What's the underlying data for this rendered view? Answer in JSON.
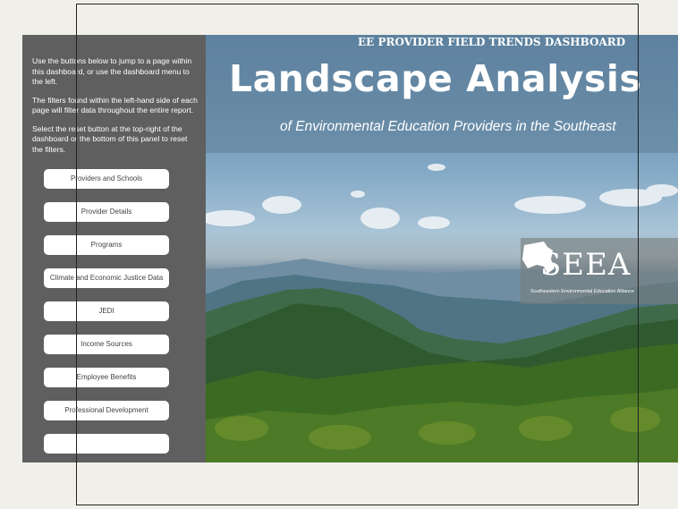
{
  "sidebar": {
    "intro": [
      "Use the buttons below to jump to a page within this dashboard, or use the dashboard menu to the left.",
      "The filters found within the left-hand side of each page will filter data throughout the entire report.",
      "Select the reset button at the top-right of the dashboard or the bottom of this panel to reset the filters."
    ],
    "nav": [
      "Providers and Schools",
      "Provider Details",
      "Programs",
      "Climate and Economic Justice Data",
      "JEDI",
      "Income Sources",
      "Employee Benefits",
      "Professional Development",
      ""
    ]
  },
  "hero": {
    "kicker": "EE PROVIDER FIELD TRENDS DASHBOARD",
    "title": "Landscape Analysis",
    "subtitle": "of Environmental Education Providers in the Southeast",
    "logo_text": "SEEA",
    "logo_tagline": "Southeastern Environmental Education Alliance"
  },
  "colors": {
    "sidebar_bg": "#5f5f5f",
    "page_bg": "#f0efe9",
    "button_bg": "#ffffff"
  }
}
